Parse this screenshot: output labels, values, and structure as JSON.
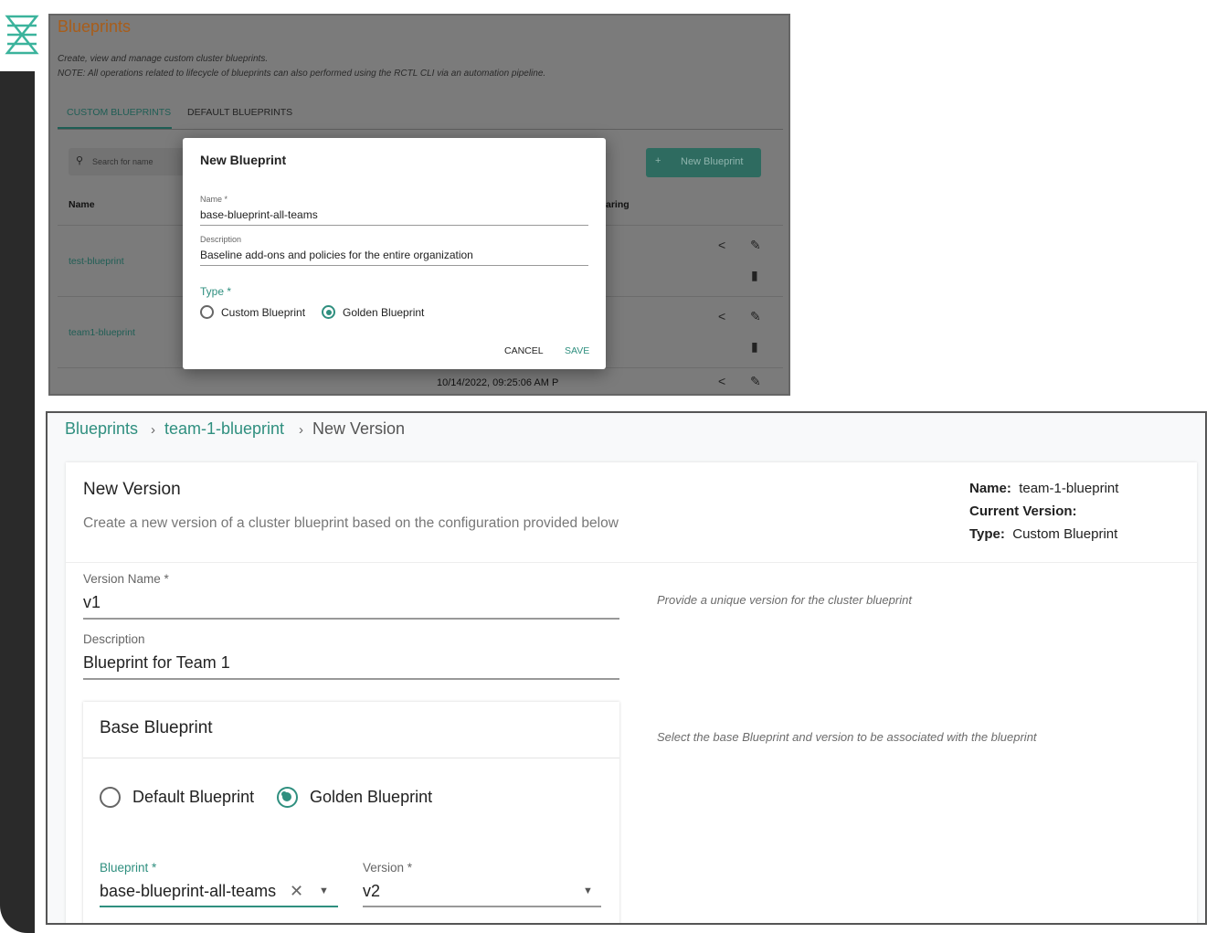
{
  "colors": {
    "accent": "#2f8f7f",
    "title_orange": "#a85d1a",
    "sidebar": "#2a2a2a"
  },
  "top": {
    "title": "Blueprints",
    "subtitle": "Create, view and manage custom cluster blueprints.",
    "note": "NOTE: All operations related to lifecycle of blueprints can also performed using the RCTL CLI via an automation pipeline.",
    "tabs": [
      {
        "label": "CUSTOM BLUEPRINTS",
        "active": true
      },
      {
        "label": "DEFAULT BLUEPRINTS",
        "active": false
      }
    ],
    "search_placeholder": "Search for name",
    "new_button": "New Blueprint",
    "new_button_icon": "+",
    "columns": {
      "name": "Name",
      "sharing": "aring"
    },
    "rows": [
      {
        "name": "test-blueprint"
      },
      {
        "name": "team1-blueprint"
      }
    ],
    "partial_timestamp": "10/14/2022, 09:25:06 AM P",
    "modal": {
      "title": "New Blueprint",
      "name_label": "Name *",
      "name_value": "base-blueprint-all-teams",
      "desc_label": "Description",
      "desc_value": "Baseline add-ons and policies for the entire organization",
      "type_label": "Type *",
      "options": [
        {
          "label": "Custom Blueprint",
          "selected": false
        },
        {
          "label": "Golden Blueprint",
          "selected": true
        }
      ],
      "cancel": "CANCEL",
      "save": "SAVE"
    }
  },
  "bottom": {
    "breadcrumb": [
      "Blueprints",
      "team-1-blueprint",
      "New Version"
    ],
    "separator": "›",
    "heading": "New Version",
    "subheading": "Create a new version of a cluster blueprint based on the configuration provided below",
    "info": {
      "name_label": "Name:",
      "name_value": "team-1-blueprint",
      "version_label": "Current Version:",
      "type_label": "Type:",
      "type_value": "Custom Blueprint"
    },
    "version_label": "Version Name *",
    "version_value": "v1",
    "version_hint": "Provide a unique version for the cluster blueprint",
    "desc_label": "Description",
    "desc_value": "Blueprint for Team 1",
    "base_title": "Base Blueprint",
    "base_hint": "Select the base Blueprint and version to be associated with the blueprint",
    "base_options": [
      {
        "label": "Default Blueprint",
        "selected": false
      },
      {
        "label": "Golden Blueprint",
        "selected": true
      }
    ],
    "blueprint_label": "Blueprint *",
    "blueprint_value": "base-blueprint-all-teams",
    "bversion_label": "Version *",
    "bversion_value": "v2"
  }
}
